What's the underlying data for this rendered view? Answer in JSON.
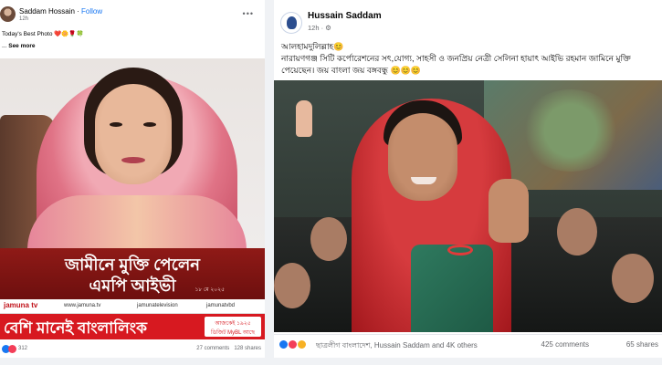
{
  "left_post": {
    "author": "Saddam Hossain",
    "separator": " · ",
    "follow_label": "Follow",
    "time": "12h",
    "more_icon": "more-dots-icon",
    "text": "Today's Best Photo ❤️🌼🌹🍀",
    "see_more_prefix": "... ",
    "see_more_label": "See more",
    "headline_line1": "জামীনে মুক্তি পেলেন",
    "headline_line2": "এমপি আইভী",
    "date": "১৮ মে ২০২৫",
    "strip": {
      "logo": "jamuna tv",
      "website": "www.jamuna.tv",
      "facebook": "jamunatelevision",
      "youtube": "jamunatvbd"
    },
    "ad": {
      "slogan": "বেশি মানেই বাংলালিংক",
      "line1": "আজকেই ১৯২৫",
      "line2": "ডিজিট MyBL আছে"
    },
    "reactions_count": "312",
    "comments": "27 comments",
    "shares": "128 shares"
  },
  "right_post": {
    "author": "Hussain Saddam",
    "time": "12h · ⚙",
    "text_line1": "আলহামদুলিল্লাহ😊",
    "text_line2": "নারায়ণগঞ্জ সিটি কর্পোরেশনের সৎ,যোগ্য, সাহসী ও জনপ্রিয় নেত্রী সেলিনা হায়াৎ আইভি রহমান জামিনে মুক্তি",
    "text_line3": "পেয়েছেন। জয় বাংলা জয় বঙ্গবন্ধু 😊😊😊",
    "reaction_names": "ছাত্রলীগ বাংলাদেশ, Hussain Saddam and 4K others",
    "comments": "425 comments",
    "shares": "65 shares"
  },
  "colors": {
    "facebook_blue": "#1877f2",
    "headline_red": "#8f1a17",
    "ad_red": "#d71920",
    "meta_gray": "#65676b"
  }
}
